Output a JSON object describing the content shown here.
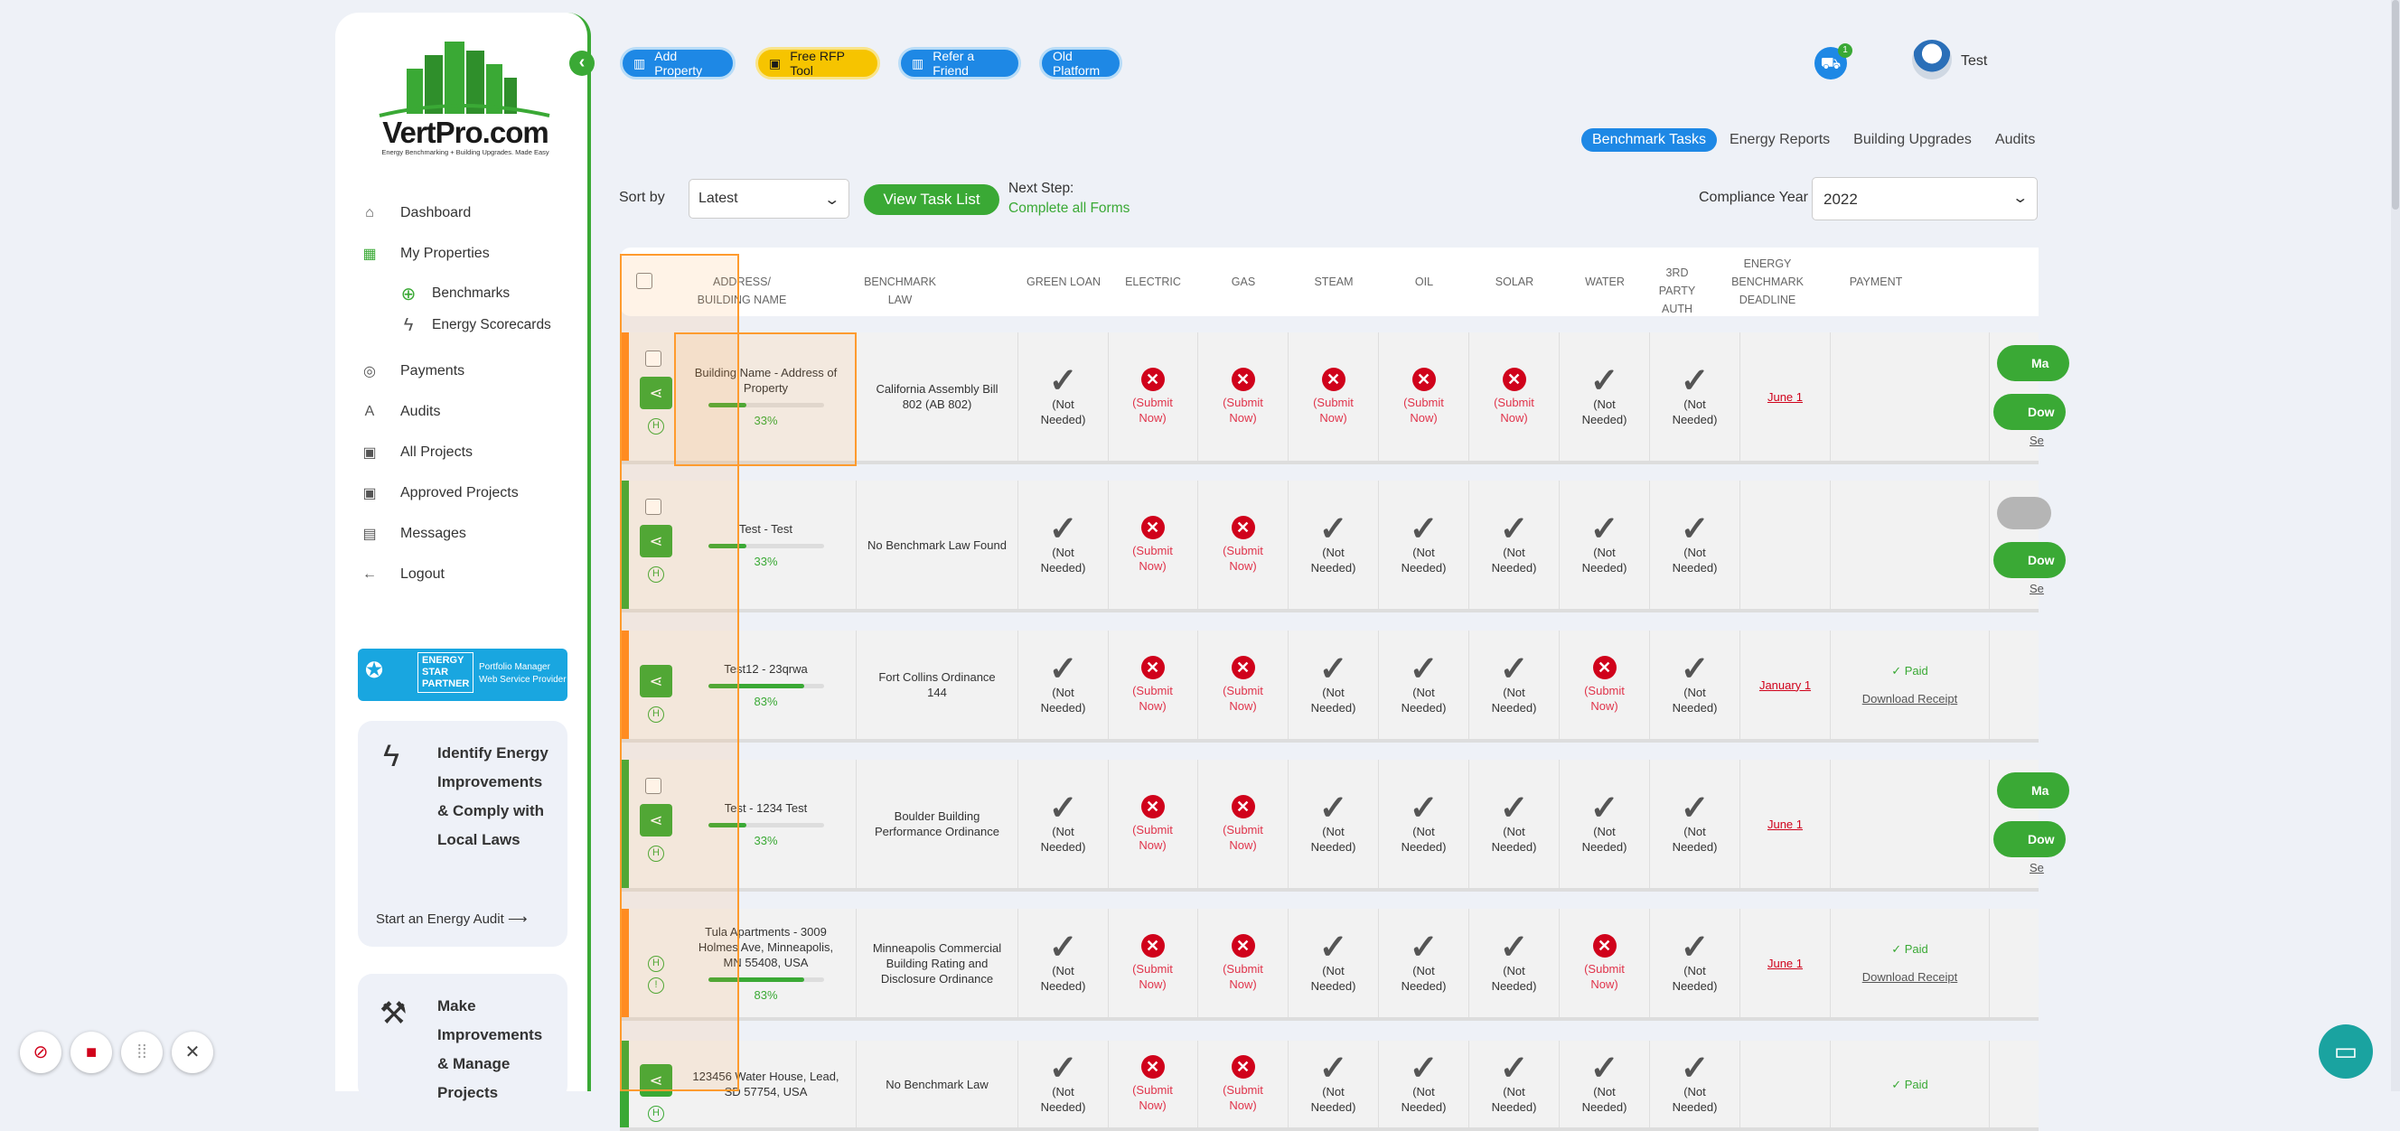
{
  "brand": {
    "name": "VertPro.com",
    "tagline": "Energy Benchmarking + Building Upgrades. Made Easy"
  },
  "sidebar": {
    "items": [
      {
        "label": "Dashboard",
        "icon": "home-icon"
      },
      {
        "label": "My Properties",
        "icon": "building-icon"
      },
      {
        "label": "Payments",
        "icon": "coin-icon"
      },
      {
        "label": "Audits",
        "icon": "audit-icon"
      },
      {
        "label": "All Projects",
        "icon": "projects-icon"
      },
      {
        "label": "Approved Projects",
        "icon": "approved-icon"
      },
      {
        "label": "Messages",
        "icon": "message-icon"
      },
      {
        "label": "Logout",
        "icon": "logout-icon"
      }
    ],
    "sub_items": [
      {
        "label": "Benchmarks",
        "icon": "target-icon"
      },
      {
        "label": "Energy Scorecards",
        "icon": "bolt-icon"
      }
    ],
    "energy_star": {
      "line1": "ENERGY",
      "line2": "STAR",
      "line3": "PARTNER",
      "text1": "Portfolio Manager",
      "text2": "Web Service Provider"
    },
    "card1": {
      "title": "Identify Energy Improvements & Comply with Local Laws",
      "link": "Start an Energy Audit"
    },
    "card2": {
      "title": "Make Improvements & Manage Projects"
    }
  },
  "toolbar": {
    "add_property": "Add Property",
    "free_rfp": "Free RFP Tool",
    "refer": "Refer a Friend",
    "old_platform": "Old Platform",
    "cart_count": "1",
    "user": "Test"
  },
  "tabs": [
    "Benchmark Tasks",
    "Energy Reports",
    "Building Upgrades",
    "Audits"
  ],
  "filters": {
    "sort_label": "Sort by",
    "sort_value": "Latest",
    "view_task": "View Task List",
    "next_step_label": "Next Step:",
    "next_step_value": "Complete all Forms",
    "compliance_label": "Compliance Year",
    "compliance_value": "2022"
  },
  "columns": [
    "ADDRESS/ BUILDING NAME",
    "BENCHMARK LAW",
    "GREEN LOAN",
    "ELECTRIC",
    "GAS",
    "STEAM",
    "OIL",
    "SOLAR",
    "WATER",
    "3RD PARTY AUTH",
    "ENERGY BENCHMARK DEADLINE",
    "PAYMENT"
  ],
  "status_labels": {
    "ok": "(Not Needed)",
    "bad": "(Submit Now)"
  },
  "rows": [
    {
      "name": "Building Name - Address of Property",
      "progress": 33,
      "pct": "33%",
      "law": "California Assembly Bill 802 (AB 802)",
      "status": [
        "ok",
        "bad",
        "bad",
        "bad",
        "bad",
        "bad",
        "ok",
        "ok"
      ],
      "deadline": "June 1",
      "paid": "",
      "receipt": "",
      "buttons": [
        "Ma",
        "Dow"
      ],
      "link": "Se"
    },
    {
      "name": "Test - Test",
      "progress": 33,
      "pct": "33%",
      "law": "No Benchmark Law Found",
      "status": [
        "ok",
        "bad",
        "bad",
        "ok",
        "ok",
        "ok",
        "ok",
        "ok"
      ],
      "deadline": "",
      "paid": "",
      "receipt": "",
      "buttons": [
        "Dow"
      ],
      "link": "Se"
    },
    {
      "name": "Test12 - 23qrwa",
      "progress": 83,
      "pct": "83%",
      "law": "Fort Collins Ordinance 144",
      "status": [
        "ok",
        "bad",
        "bad",
        "ok",
        "ok",
        "ok",
        "bad",
        "ok"
      ],
      "deadline": "January 1",
      "paid": "Paid",
      "receipt": "Download Receipt",
      "buttons": [],
      "link": ""
    },
    {
      "name": "Test - 1234 Test",
      "progress": 33,
      "pct": "33%",
      "law": "Boulder Building Performance Ordinance",
      "status": [
        "ok",
        "bad",
        "bad",
        "ok",
        "ok",
        "ok",
        "ok",
        "ok"
      ],
      "deadline": "June 1",
      "paid": "",
      "receipt": "",
      "buttons": [
        "Ma",
        "Dow"
      ],
      "link": "Se"
    },
    {
      "name": "Tula Apartments - 3009 Holmes Ave, Minneapolis, MN 55408, USA",
      "progress": 83,
      "pct": "83%",
      "law": "Minneapolis Commercial Building Rating and Disclosure Ordinance",
      "status": [
        "ok",
        "bad",
        "bad",
        "ok",
        "ok",
        "ok",
        "bad",
        "ok"
      ],
      "deadline": "June 1",
      "paid": "Paid",
      "receipt": "Download Receipt",
      "buttons": [],
      "link": ""
    },
    {
      "name": "123456 Water House, Lead, SD 57754, USA",
      "progress": 0,
      "pct": "",
      "law": "No Benchmark Law",
      "status": [
        "ok",
        "bad",
        "bad",
        "ok",
        "ok",
        "ok",
        "ok",
        "ok"
      ],
      "deadline": "",
      "paid": "Paid",
      "receipt": "",
      "buttons": [],
      "link": ""
    }
  ]
}
